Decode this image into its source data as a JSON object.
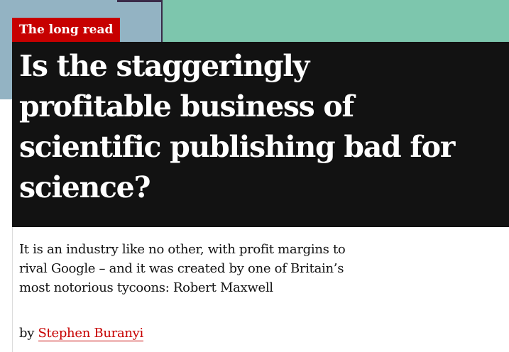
{
  "kicker": "The long read",
  "headline": "Is the staggeringly profitable business of scientific publishing bad for science?",
  "standfirst": "It is an industry like no other, with profit margins to rival Google – and it was created by one of Britain’s most notorious tycoons: Robert Maxwell",
  "byline": {
    "prefix": "by",
    "author": "Stephen Buranyi"
  },
  "colors": {
    "accent": "#c70000",
    "headline_background": "#121212",
    "illustration_blue": "#93b3c3",
    "illustration_green": "#7dc6ad"
  }
}
